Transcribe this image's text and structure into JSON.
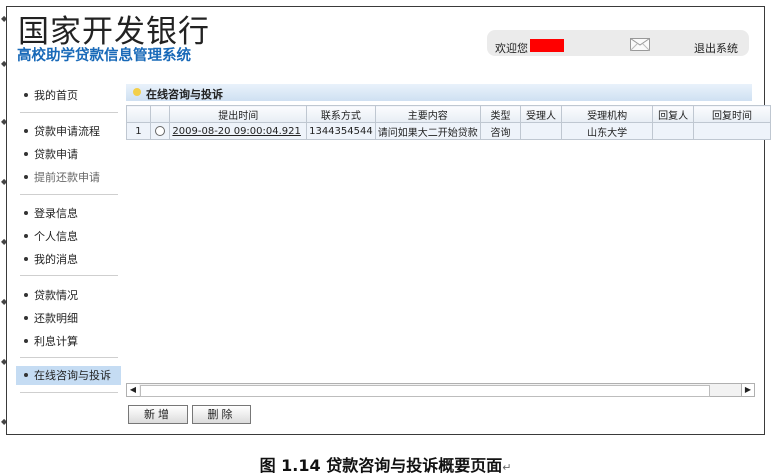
{
  "header": {
    "bank_name": "国家开发银行",
    "system_name": "高校助学贷款信息管理系统",
    "welcome_label": "欢迎您",
    "logout_label": "退出系统"
  },
  "sidebar": {
    "groups": [
      [
        "我的首页"
      ],
      [
        "贷款申请流程",
        "贷款申请",
        "提前还款申请"
      ],
      [
        "登录信息",
        "个人信息",
        "我的消息"
      ],
      [
        "贷款情况",
        "还款明细",
        "利息计算"
      ],
      [
        "在线咨询与投诉"
      ]
    ]
  },
  "panel": {
    "title": "在线咨询与投诉",
    "columns": [
      "",
      "",
      "提出时间",
      "联系方式",
      "主要内容",
      "类型",
      "受理人",
      "受理机构",
      "回复人",
      "回复时间"
    ],
    "rows": [
      [
        "1",
        "",
        "2009-08-20 09:00:04.921",
        "1344354544",
        "请问如果大二开始贷款",
        "咨询",
        "",
        "山东大学",
        "",
        ""
      ]
    ]
  },
  "buttons": {
    "add_label": "新增",
    "delete_label": "删除"
  },
  "caption": "图 1.14 贷款咨询与投诉概要页面",
  "caption_mark": "↵",
  "colors": {
    "logo_blue": "#1869b8",
    "active_item_bg": "#c5dcf3",
    "redacted": "#ff0000"
  }
}
